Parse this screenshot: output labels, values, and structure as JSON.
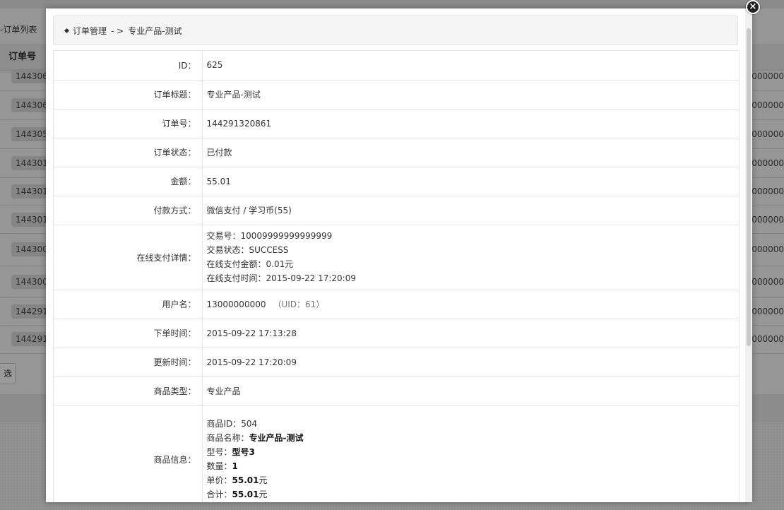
{
  "background": {
    "list_title": "-订单列表",
    "table_header_first_col": "订单号",
    "rows": [
      {
        "left": "144306",
        "right": "000000"
      },
      {
        "left": "144306",
        "right": "000000"
      },
      {
        "left": "144305",
        "right": "000000"
      },
      {
        "left": "144301",
        "right": "000000"
      },
      {
        "left": "144301",
        "right": "000000"
      },
      {
        "left": "144301",
        "right": "000000"
      },
      {
        "left": "144300",
        "right": "000000"
      },
      {
        "left": "144300",
        "right": "000000"
      },
      {
        "left": "144291",
        "right": "000000"
      },
      {
        "left": "144291",
        "right": "000000"
      }
    ],
    "button_fragment": "选"
  },
  "breadcrumb": {
    "section": "订单管理",
    "separator": "- >",
    "current": "专业产品-测试"
  },
  "detail": {
    "id_label": "ID：",
    "id_value": "625",
    "title_label": "订单标题：",
    "title_value": "专业产品-测试",
    "order_no_label": "订单号：",
    "order_no_value": "144291320861",
    "status_label": "订单状态：",
    "status_value": "已付款",
    "amount_label": "金额：",
    "amount_value": "55.01",
    "pay_method_label": "付款方式：",
    "pay_method_value": "微信支付 / 学习币(55)",
    "online_label": "在线支付详情：",
    "online_lines": {
      "trade_no_label": "交易号：",
      "trade_no_value": "10009999999999999",
      "trade_status_label": "交易状态：",
      "trade_status_value": "SUCCESS",
      "paid_amount_label": "在线支付金额：",
      "paid_amount_value": "0.01元",
      "paid_time_label": "在线支付时间：",
      "paid_time_value": "2015-09-22 17:20:09"
    },
    "username_label": "用户名：",
    "username_value": "13000000000",
    "uid_text": "（UID：61）",
    "created_label": "下单时间：",
    "created_value": "2015-09-22 17:13:28",
    "updated_label": "更新时间：",
    "updated_value": "2015-09-22 17:20:09",
    "product_type_label": "商品类型：",
    "product_type_value": "专业产品",
    "product_info_label": "商品信息：",
    "product_info": {
      "id_label": "商品ID：",
      "id_value": "504",
      "name_label": "商品名称：",
      "name_value": "专业产品-测试",
      "model_label": "型号：",
      "model_value": "型号3",
      "qty_label": "数量：",
      "qty_value": "1",
      "unit_price_label": "单价：",
      "unit_price_value": "55.01",
      "unit_price_unit": "元",
      "total_label": "合计：",
      "total_value": "55.01",
      "total_unit": "元"
    }
  },
  "close_icon": "close-icon"
}
